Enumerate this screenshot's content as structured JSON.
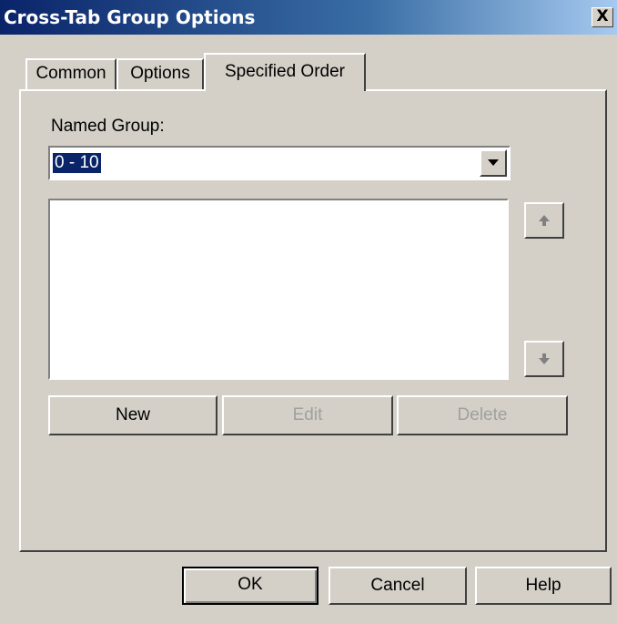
{
  "window": {
    "title": "Cross-Tab Group Options",
    "close_label": "X"
  },
  "tabs": [
    {
      "label": "Common",
      "active": false
    },
    {
      "label": "Options",
      "active": false
    },
    {
      "label": "Specified Order",
      "active": true
    }
  ],
  "named_group": {
    "label": "Named Group:",
    "value": "0 - 10"
  },
  "list": {
    "items": []
  },
  "order_buttons": {
    "up_icon": "arrow-up-icon",
    "down_icon": "arrow-down-icon"
  },
  "group_buttons": {
    "new_label": "New",
    "edit_label": "Edit",
    "delete_label": "Delete"
  },
  "dialog_buttons": {
    "ok_label": "OK",
    "cancel_label": "Cancel",
    "help_label": "Help"
  }
}
